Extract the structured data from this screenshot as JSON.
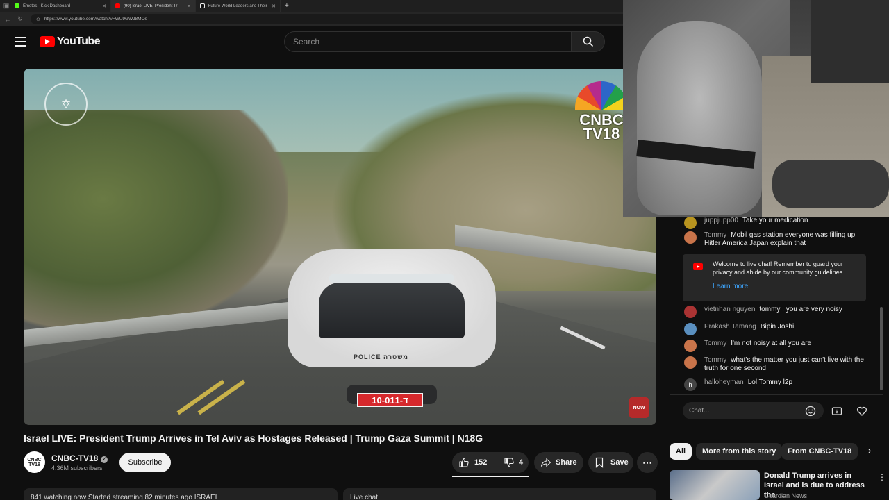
{
  "browser": {
    "tabs": [
      {
        "label": "Emotes - Kick Dashboard",
        "color": "#53fc18"
      },
      {
        "label": "(90) Israel LIVE: President Tr",
        "color": "#ff0000"
      },
      {
        "label": "Future World Leaders and Their I",
        "color": "#eeeeee"
      }
    ],
    "url": "https://www.youtube.com/watch?v=WU9GWJ8MOs"
  },
  "header": {
    "logo_text": "YouTube",
    "search_placeholder": "Search"
  },
  "video": {
    "plate_text": "10-011-ד",
    "police_text": "POLICE משטרה",
    "cnbc_line1": "CNBC",
    "cnbc_line2": "TV18",
    "badge_text": "NOW"
  },
  "chat": {
    "messages_top": [
      {
        "author": "juppjupp00",
        "text": "Take your medication",
        "avatar_color": "#b8941f"
      },
      {
        "author": "Tommy",
        "text": "Mobil gas station everyone was filling up Hitler America Japan explain that",
        "avatar_color": "#c9744a"
      }
    ],
    "notice": {
      "text": "Welcome to live chat! Remember to guard your privacy and abide by our community guidelines.",
      "link": "Learn more"
    },
    "messages_bottom": [
      {
        "author": "vietnhan nguyen",
        "text": "tommy , you are very noisy",
        "avatar_color": "#a33"
      },
      {
        "author": "Prakash Tamang",
        "text": "Bipin Joshi",
        "avatar_color": "#5a8fbf"
      },
      {
        "author": "Tommy",
        "text": "I'm not noisy at all you are",
        "avatar_color": "#c9744a"
      },
      {
        "author": "Tommy",
        "text": "what's the matter you just can't live with the truth for one second",
        "avatar_color": "#c9744a"
      },
      {
        "author": "halloheyman",
        "text": "Lol Tommy l2p",
        "avatar_color": "#444",
        "initial": "h"
      }
    ],
    "input_placeholder": "Chat..."
  },
  "title": "Israel LIVE: President Trump Arrives in Tel Aviv as Hostages Released | Trump Gaza Summit | N18G",
  "channel": {
    "avatar_text": "CNBC TV18",
    "name": "CNBC-TV18",
    "subscribers": "4.36M subscribers",
    "subscribe_label": "Subscribe"
  },
  "actions": {
    "likes": "152",
    "dislikes": "4",
    "share": "Share",
    "save": "Save"
  },
  "bottom": {
    "description_preview": "841 watching now  Started streaming 82 minutes ago  ISRAEL",
    "live_chat_label": "Live chat"
  },
  "chips": [
    "All",
    "More from this story",
    "From CNBC-TV18"
  ],
  "recommendation": {
    "title": "Donald Trump arrives in Israel and is due to address the ...",
    "channel": "Guardian News"
  },
  "colors": {
    "background": "#0f0f0f",
    "yt_red": "#ff0000",
    "link_blue": "#3ea6ff"
  }
}
